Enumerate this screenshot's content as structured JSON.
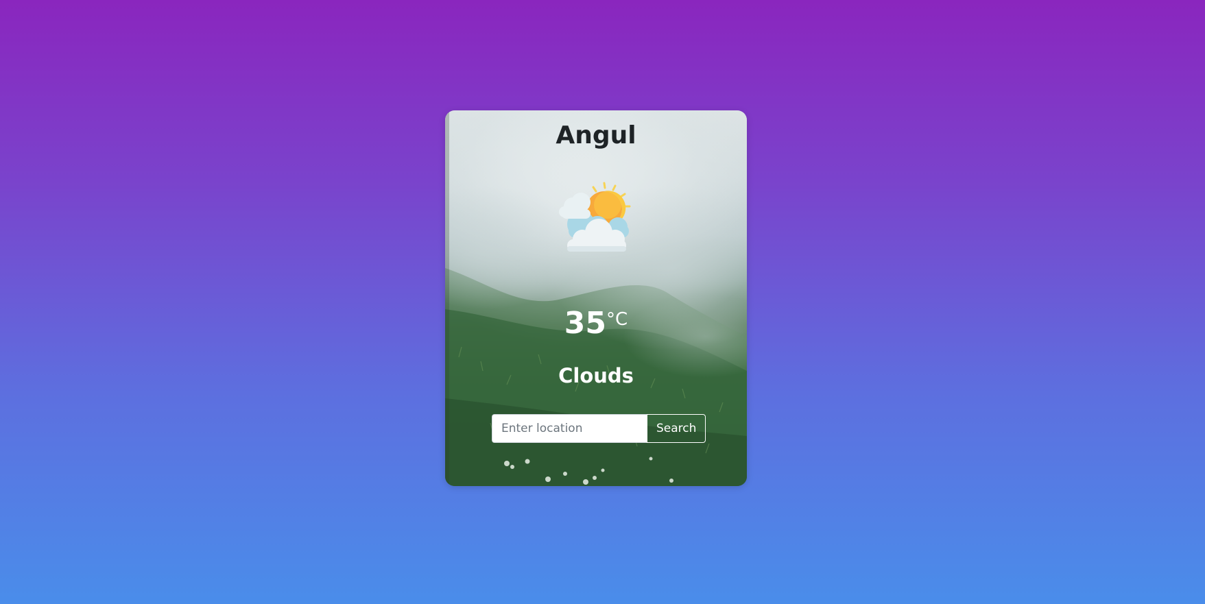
{
  "weather_card": {
    "city": "Angul",
    "icon": "sun-behind-clouds-icon",
    "temperature": "35",
    "temperature_unit": "°C",
    "condition": "Clouds",
    "background": "misty-green-hillside-photo"
  },
  "search": {
    "placeholder": "Enter location",
    "value": "",
    "button_label": "Search"
  },
  "colors": {
    "gradient_top": "#8a26be",
    "gradient_bottom": "#4a8dea",
    "city_text": "#1e2326",
    "card_text": "#ffffff"
  }
}
